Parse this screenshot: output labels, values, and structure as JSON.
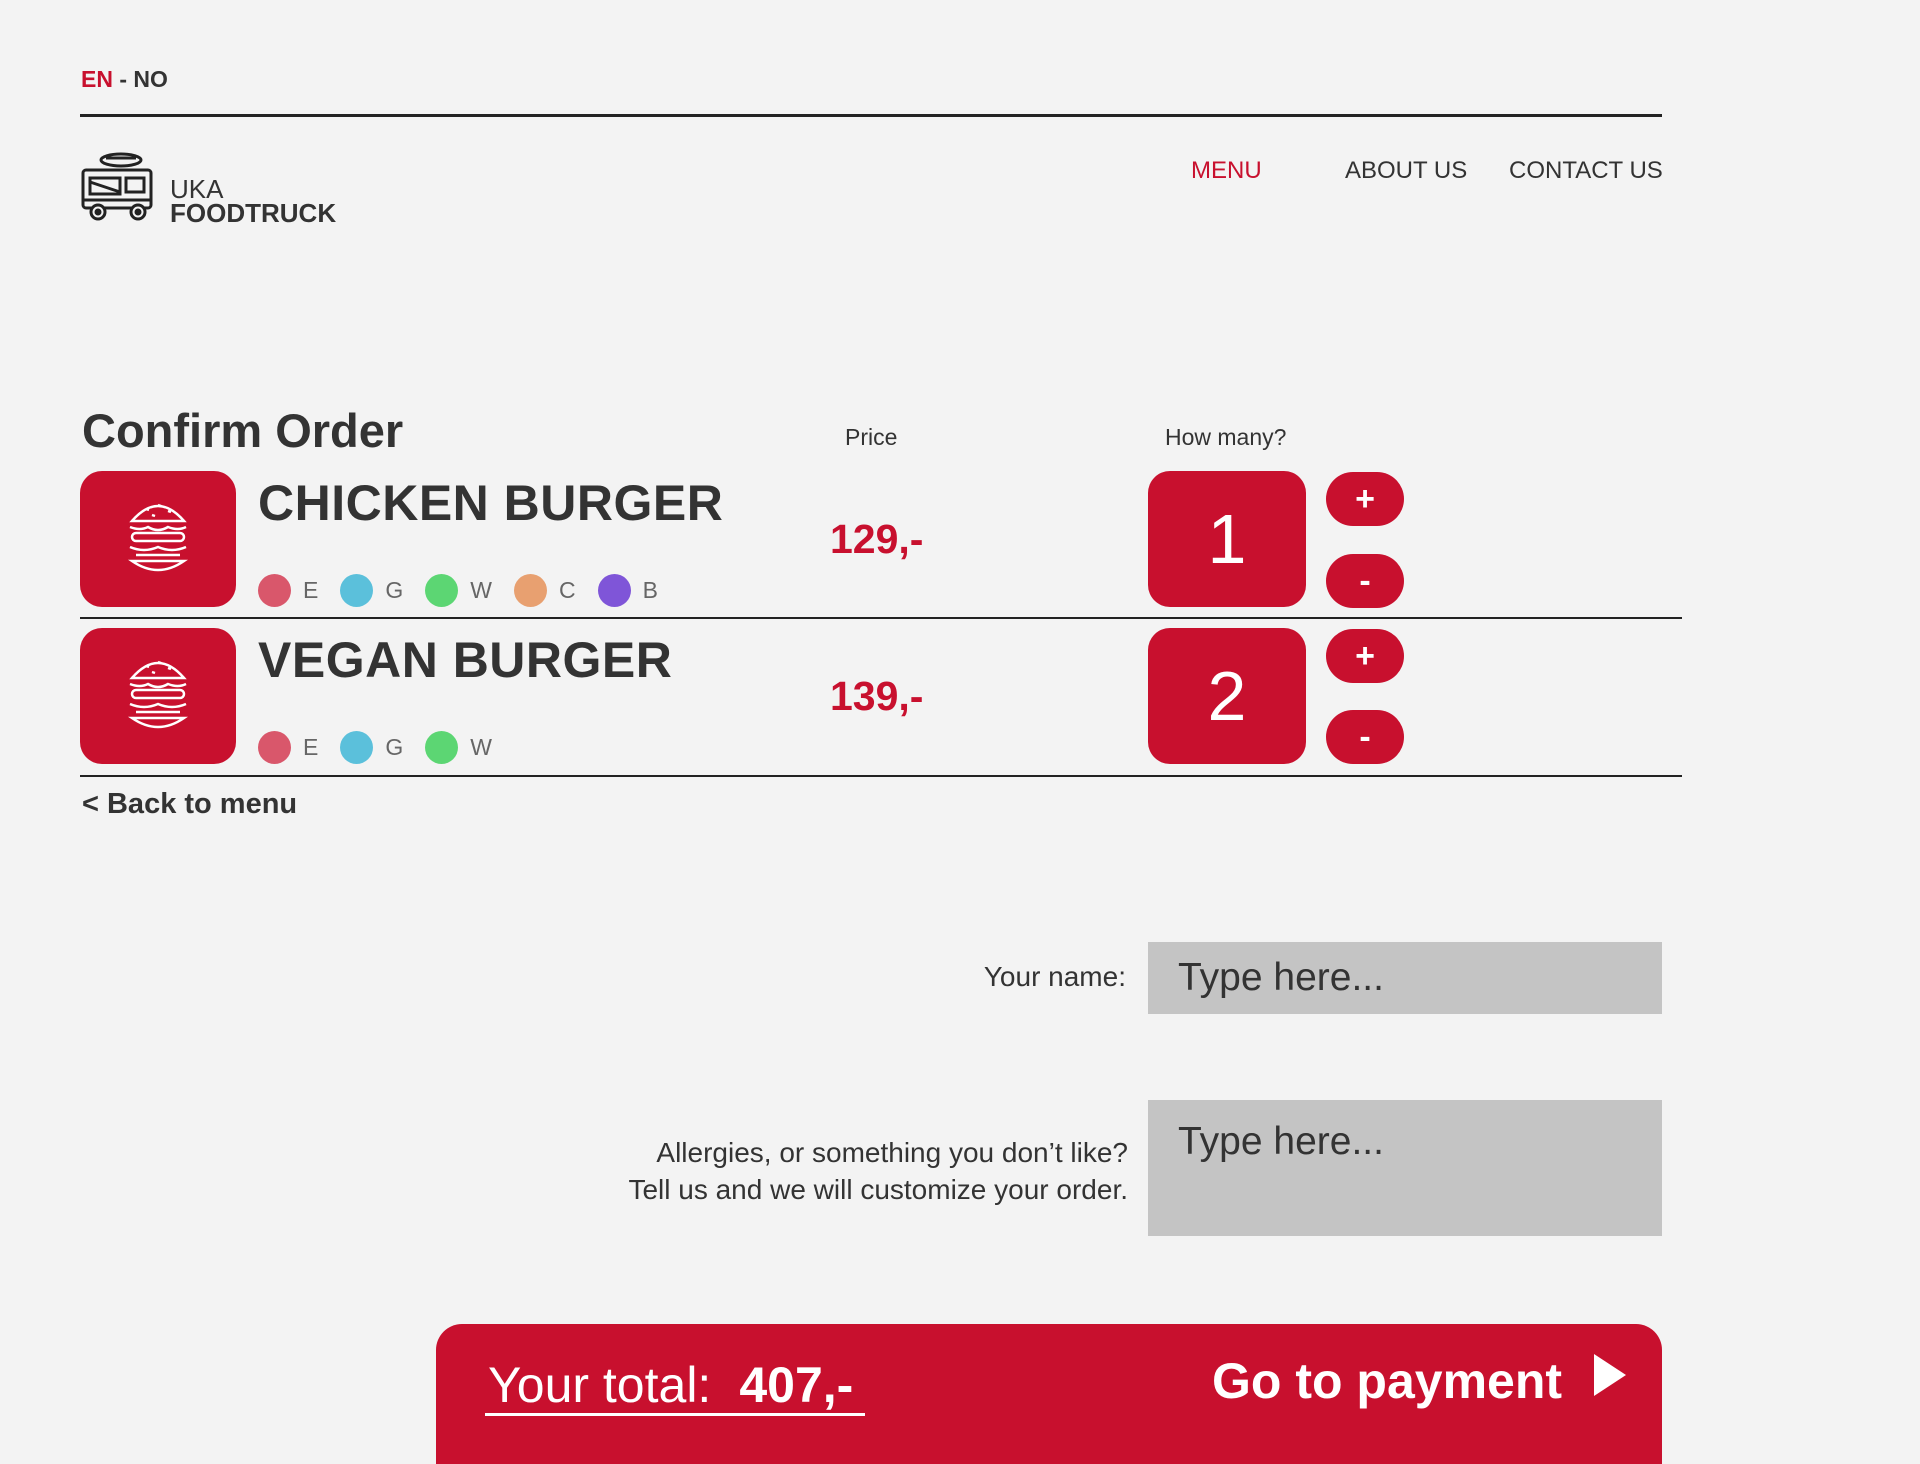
{
  "lang": {
    "active": "EN",
    "separator": "-",
    "other": "NO"
  },
  "logo": {
    "line1": "UKA",
    "line2": "FOODTRUCK"
  },
  "nav": {
    "menu": "MENU",
    "about": "ABOUT US",
    "contact": "CONTACT US"
  },
  "page": {
    "title": "Confirm Order",
    "price_header": "Price",
    "qty_header": "How many?"
  },
  "items": [
    {
      "name": "CHICKEN BURGER",
      "price": "129,-",
      "quantity": "1",
      "allergens": [
        {
          "label": "E",
          "color": "#d9576b"
        },
        {
          "label": "G",
          "color": "#5bc0db"
        },
        {
          "label": "W",
          "color": "#5cd673"
        },
        {
          "label": "C",
          "color": "#e8a070"
        },
        {
          "label": "B",
          "color": "#7f55d8"
        }
      ]
    },
    {
      "name": "VEGAN BURGER",
      "price": "139,-",
      "quantity": "2",
      "allergens": [
        {
          "label": "E",
          "color": "#d9576b"
        },
        {
          "label": "G",
          "color": "#5bc0db"
        },
        {
          "label": "W",
          "color": "#5cd673"
        }
      ]
    }
  ],
  "buttons": {
    "plus": "+",
    "minus": "-"
  },
  "back_link": "< Back to menu",
  "form": {
    "name_label": "Your name:",
    "name_placeholder": "Type here...",
    "allergy_label_1": "Allergies, or something you don’t like?",
    "allergy_label_2": "Tell us and we will customize your order.",
    "allergy_placeholder": "Type here..."
  },
  "total": {
    "label": "Your total:",
    "amount": "407,-",
    "pay_label": "Go to payment"
  },
  "colors": {
    "accent": "#c8102e",
    "background": "#f3f3f3",
    "input_bg": "#c4c4c4",
    "text": "#333333"
  }
}
